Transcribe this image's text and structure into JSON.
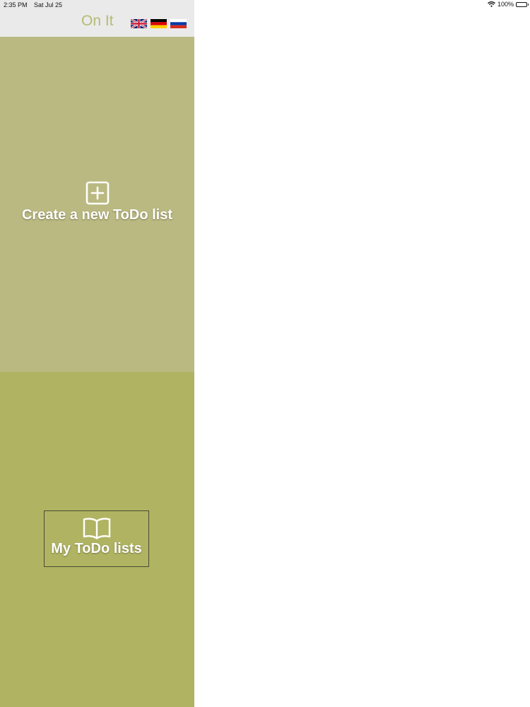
{
  "status_bar": {
    "time": "2:35 PM",
    "date": "Sat Jul 25",
    "battery": "100%"
  },
  "header": {
    "title": "On It",
    "flags": [
      {
        "name": "flag-uk-icon"
      },
      {
        "name": "flag-germany-icon"
      },
      {
        "name": "flag-russia-icon"
      }
    ]
  },
  "create_panel": {
    "label": "Create a new ToDo list",
    "icon": "plus-square-icon"
  },
  "mylists_panel": {
    "label": "My ToDo lists",
    "icon": "book-icon"
  },
  "colors": {
    "header_bg": "#eaeaea",
    "title": "#b5bc74",
    "create_bg": "#bab981",
    "mylists_bg": "#b0b462"
  }
}
